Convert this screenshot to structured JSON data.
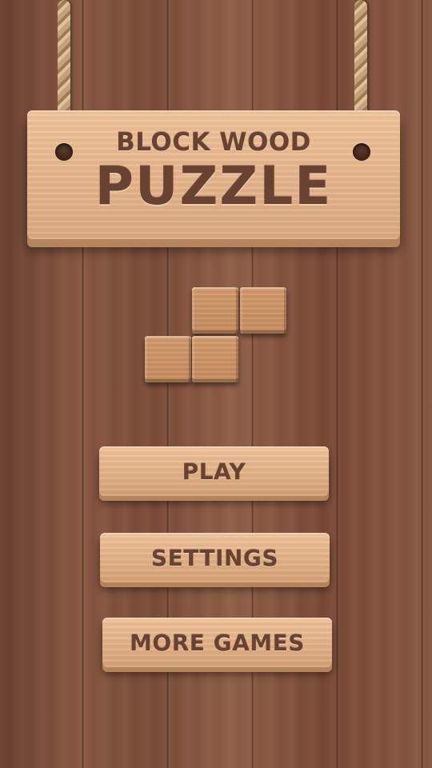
{
  "title": {
    "line1": "BLOCK WOOD",
    "line2": "PUZZLE"
  },
  "menu": {
    "play": "PLAY",
    "settings": "SETTINGS",
    "more_games": "MORE GAMES"
  },
  "colors": {
    "background_wood": "#7c4d39",
    "board_wood": "#e7b78d",
    "block_wood": "#c68b5e",
    "text_engraved": "#6a4231"
  }
}
